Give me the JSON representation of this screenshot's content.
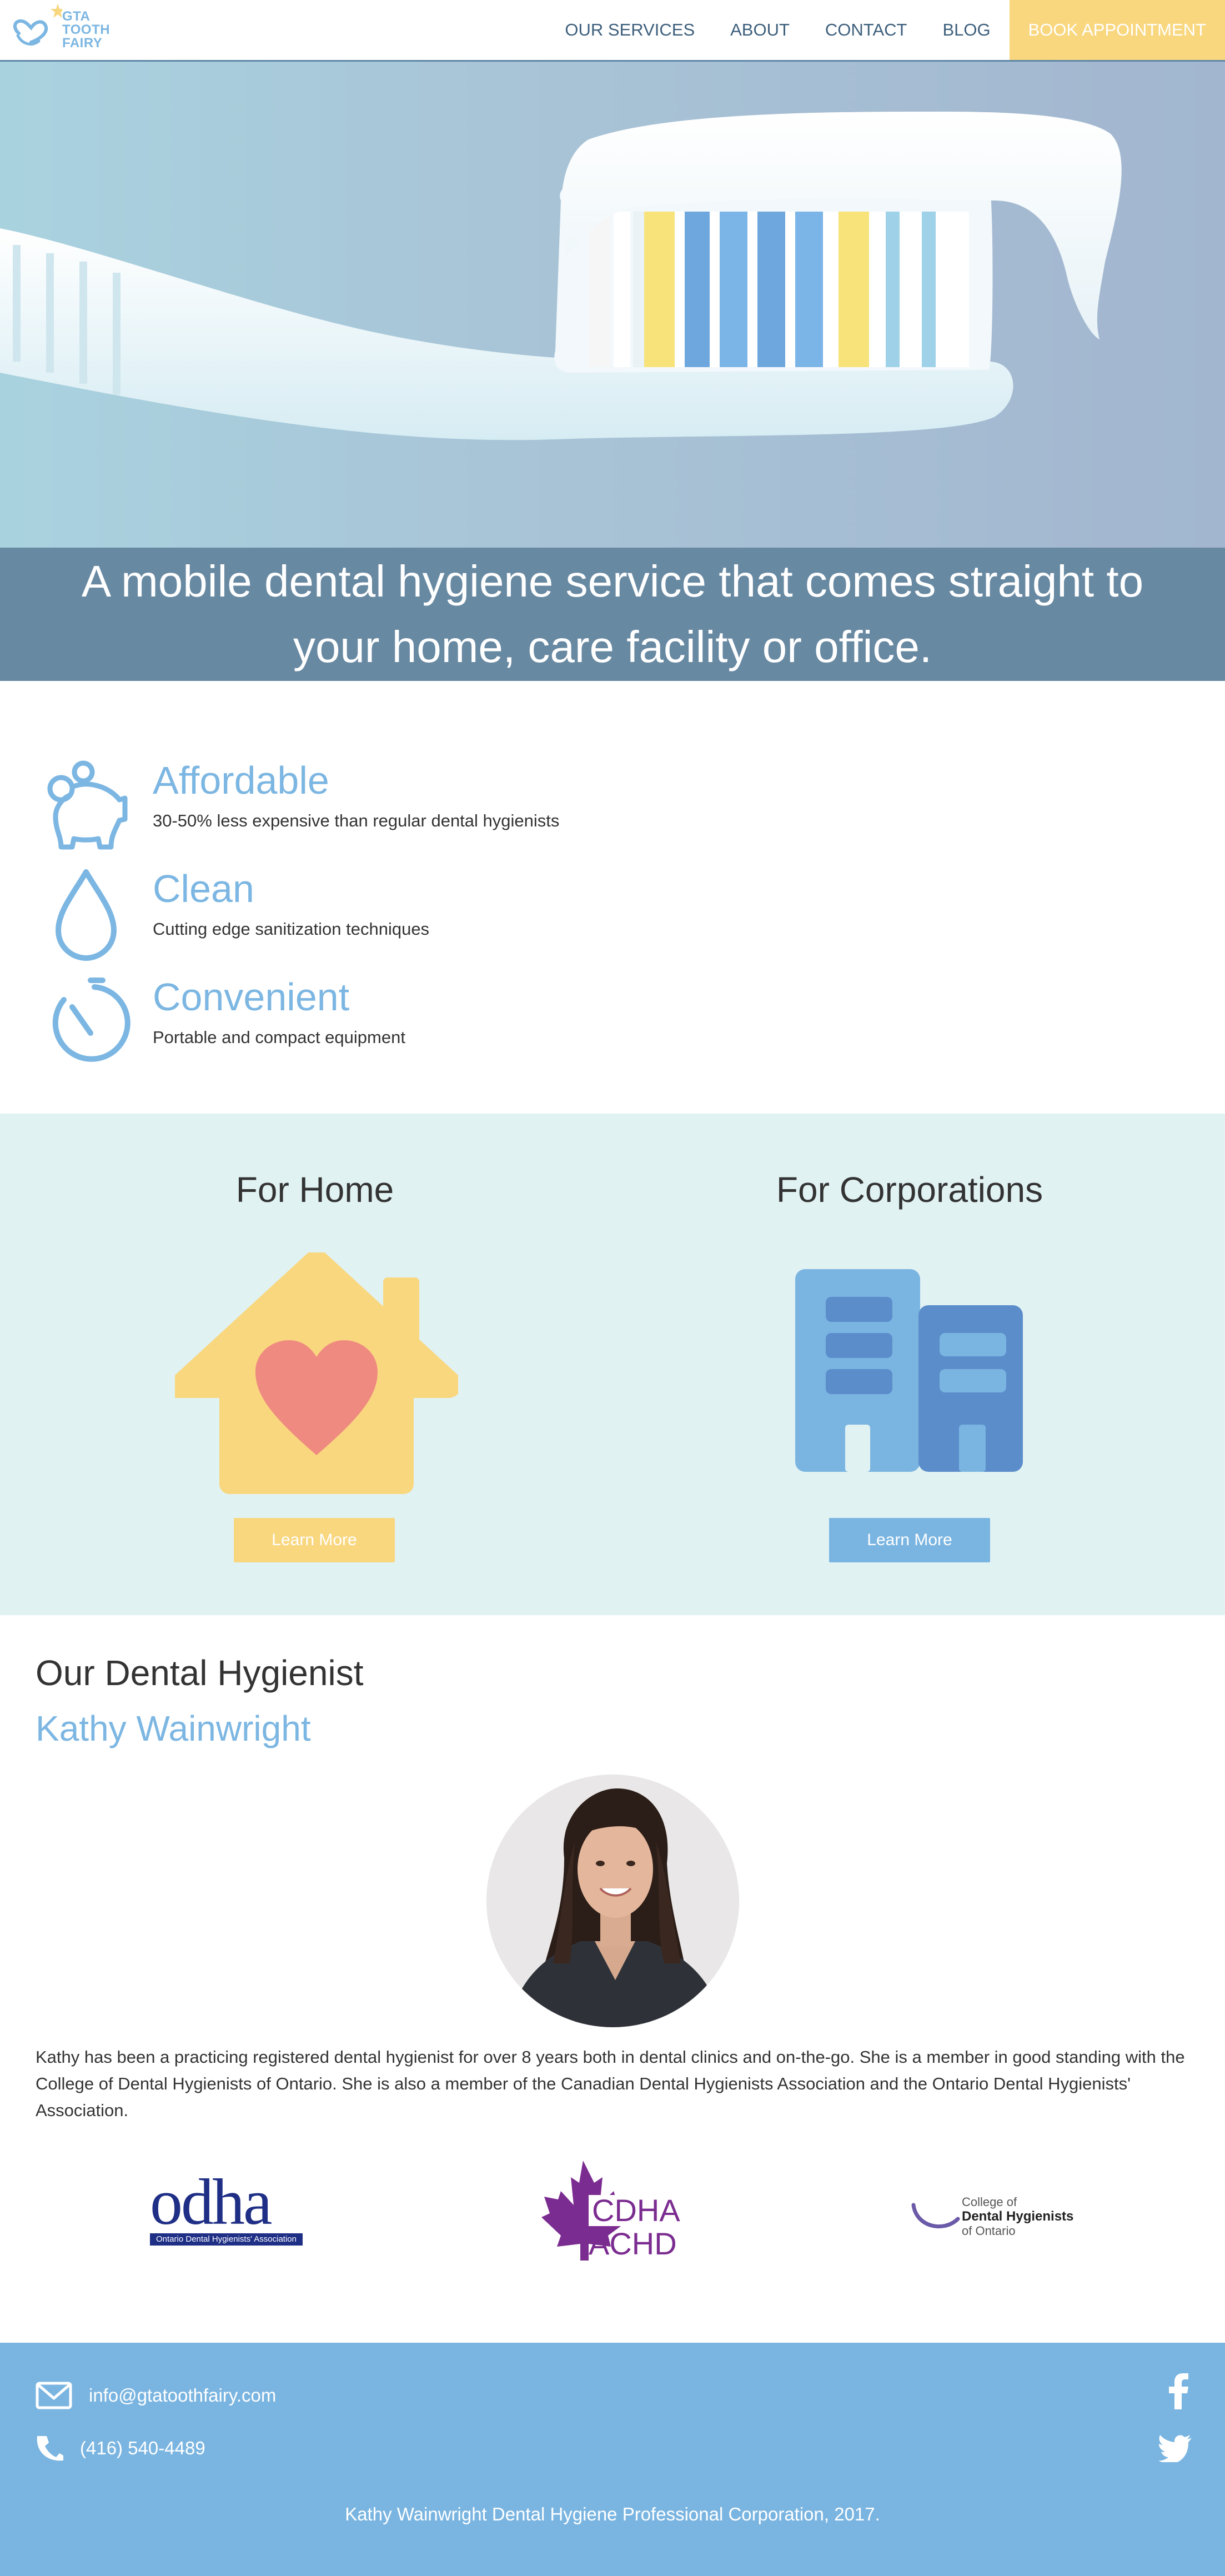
{
  "brand": {
    "logo_lines": [
      "GTA",
      "TOOTH",
      "FAIRY"
    ],
    "primary_color": "#7cb6e2",
    "accent_color": "#f9d77f"
  },
  "nav": {
    "items": [
      "OUR SERVICES",
      "ABOUT",
      "CONTACT",
      "BLOG"
    ],
    "cta": "BOOK APPOINTMENT"
  },
  "hero": {
    "image_icon": "toothbrush-illustration",
    "headline": "A mobile dental hygiene service that comes straight to your home, care facility or office."
  },
  "features": [
    {
      "icon": "piggy-bank-icon",
      "title": "Affordable",
      "text": "30-50% less expensive than regular dental hygienists"
    },
    {
      "icon": "water-drop-icon",
      "title": "Clean",
      "text": "Cutting edge sanitization techniques"
    },
    {
      "icon": "stopwatch-icon",
      "title": "Convenient",
      "text": "Portable and compact equipment"
    }
  ],
  "services": {
    "background": "#e1f2f3",
    "home": {
      "title": "For Home",
      "icon": "house-heart-icon",
      "button": "Learn More",
      "button_color": "#f9d77f"
    },
    "corporate": {
      "title": "For Corporations",
      "icon": "office-buildings-icon",
      "button": "Learn More",
      "button_color": "#7ab5e1"
    }
  },
  "hygienist": {
    "heading": "Our Dental Hygienist",
    "name": "Kathy Wainwright",
    "bio": "Kathy has been a practicing registered dental hygienist for over 8 years both in dental clinics and on-the-go. She is a member in good standing with the College of Dental Hygienists of Ontario. She is also a member of the Canadian Dental Hygienists Association and the Ontario Dental Hygienists' Association.",
    "associations": [
      {
        "logo": "odha",
        "text": "odha",
        "sub": "Ontario Dental Hygienists' Association"
      },
      {
        "logo": "cdha",
        "line1": "CDHA",
        "line2": "ACHD"
      },
      {
        "logo": "cdho",
        "line1": "College of",
        "line2": "Dental Hygienists",
        "line3": "of Ontario"
      }
    ]
  },
  "footer": {
    "email": "info@gtatoothfairy.com",
    "phone": "(416) 540-4489",
    "copyright": "Kathy Wainwright Dental Hygiene Professional Corporation, 2017.",
    "social": [
      "facebook-icon",
      "twitter-icon"
    ]
  }
}
